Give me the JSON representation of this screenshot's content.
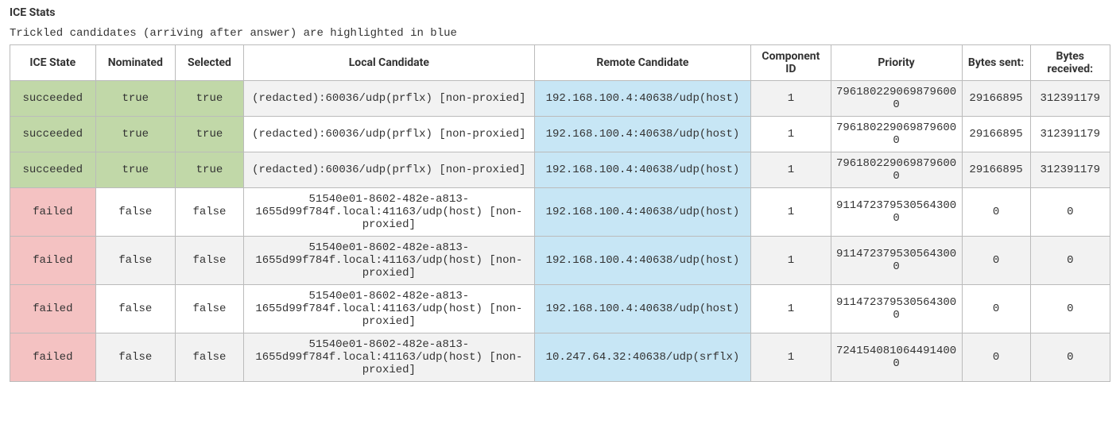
{
  "heading": "ICE Stats",
  "note": "Trickled candidates (arriving after answer) are highlighted in blue",
  "headers": {
    "ice_state": "ICE State",
    "nominated": "Nominated",
    "selected": "Selected",
    "local": "Local Candidate",
    "remote": "Remote Candidate",
    "component": "Component ID",
    "priority": "Priority",
    "bytes_sent": "Bytes sent:",
    "bytes_received": "Bytes received:"
  },
  "rows": [
    {
      "ice_state": "succeeded",
      "nominated": "true",
      "selected": "true",
      "local": "(redacted):60036/udp(prflx) [non-proxied]",
      "remote": "192.168.100.4:40638/udp(host)",
      "component": "1",
      "priority": "7961802290698796000",
      "bytes_sent": "29166895",
      "bytes_received": "312391179",
      "state_class": "succeeded",
      "alt": true
    },
    {
      "ice_state": "succeeded",
      "nominated": "true",
      "selected": "true",
      "local": "(redacted):60036/udp(prflx) [non-proxied]",
      "remote": "192.168.100.4:40638/udp(host)",
      "component": "1",
      "priority": "7961802290698796000",
      "bytes_sent": "29166895",
      "bytes_received": "312391179",
      "state_class": "succeeded",
      "alt": false
    },
    {
      "ice_state": "succeeded",
      "nominated": "true",
      "selected": "true",
      "local": "(redacted):60036/udp(prflx) [non-proxied]",
      "remote": "192.168.100.4:40638/udp(host)",
      "component": "1",
      "priority": "7961802290698796000",
      "bytes_sent": "29166895",
      "bytes_received": "312391179",
      "state_class": "succeeded",
      "alt": true
    },
    {
      "ice_state": "failed",
      "nominated": "false",
      "selected": "false",
      "local": "51540e01-8602-482e-a813-1655d99f784f.local:41163/udp(host) [non-proxied]",
      "remote": "192.168.100.4:40638/udp(host)",
      "component": "1",
      "priority": "9114723795305643000",
      "bytes_sent": "0",
      "bytes_received": "0",
      "state_class": "failed",
      "alt": false
    },
    {
      "ice_state": "failed",
      "nominated": "false",
      "selected": "false",
      "local": "51540e01-8602-482e-a813-1655d99f784f.local:41163/udp(host) [non-proxied]",
      "remote": "192.168.100.4:40638/udp(host)",
      "component": "1",
      "priority": "9114723795305643000",
      "bytes_sent": "0",
      "bytes_received": "0",
      "state_class": "failed",
      "alt": true
    },
    {
      "ice_state": "failed",
      "nominated": "false",
      "selected": "false",
      "local": "51540e01-8602-482e-a813-1655d99f784f.local:41163/udp(host) [non-proxied]",
      "remote": "192.168.100.4:40638/udp(host)",
      "component": "1",
      "priority": "9114723795305643000",
      "bytes_sent": "0",
      "bytes_received": "0",
      "state_class": "failed",
      "alt": false
    },
    {
      "ice_state": "failed",
      "nominated": "false",
      "selected": "false",
      "local": "51540e01-8602-482e-a813-1655d99f784f.local:41163/udp(host) [non-proxied]",
      "remote": "10.247.64.32:40638/udp(srflx)",
      "component": "1",
      "priority": "7241540810644914000",
      "bytes_sent": "0",
      "bytes_received": "0",
      "state_class": "failed",
      "alt": true
    }
  ]
}
